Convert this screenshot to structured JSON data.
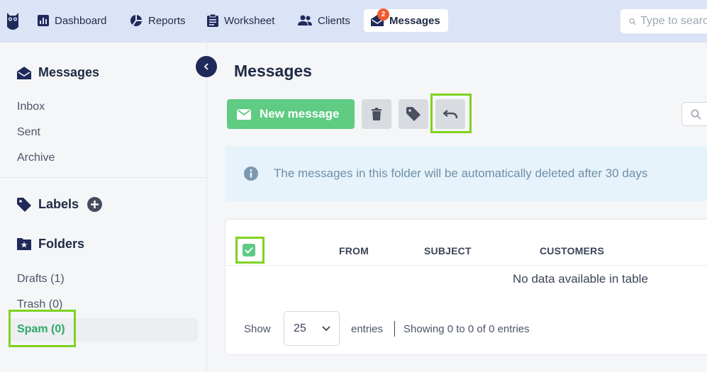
{
  "nav": {
    "items": [
      {
        "label": "Dashboard",
        "icon": "bar-chart-icon"
      },
      {
        "label": "Reports",
        "icon": "pie-chart-icon"
      },
      {
        "label": "Worksheet",
        "icon": "clipboard-icon"
      },
      {
        "label": "Clients",
        "icon": "users-icon"
      },
      {
        "label": "Messages",
        "icon": "envelope-icon",
        "badge": "2",
        "active": true
      }
    ],
    "search_placeholder": "Type to search"
  },
  "sidebar": {
    "messages_title": "Messages",
    "messages_links": [
      "Inbox",
      "Sent",
      "Archive"
    ],
    "labels_title": "Labels",
    "folders_title": "Folders",
    "folder_links": [
      "Drafts (1)",
      "Trash (0)"
    ],
    "active_folder": "Spam (0)"
  },
  "main": {
    "title": "Messages",
    "new_message_label": "New message",
    "alert_text": "The messages in this folder will be automatically deleted after 30 days",
    "table": {
      "columns": [
        "FROM",
        "SUBJECT",
        "CUSTOMERS"
      ],
      "empty_text": "No data available in table",
      "show_label": "Show",
      "page_size": "25",
      "entries_label": "entries",
      "info_text": "Showing 0 to 0 of 0 entries"
    }
  },
  "colors": {
    "accent_green": "#5fcb83",
    "highlight": "#7ed321",
    "nav_bg": "#dbe3f7",
    "badge": "#f25a2f"
  }
}
